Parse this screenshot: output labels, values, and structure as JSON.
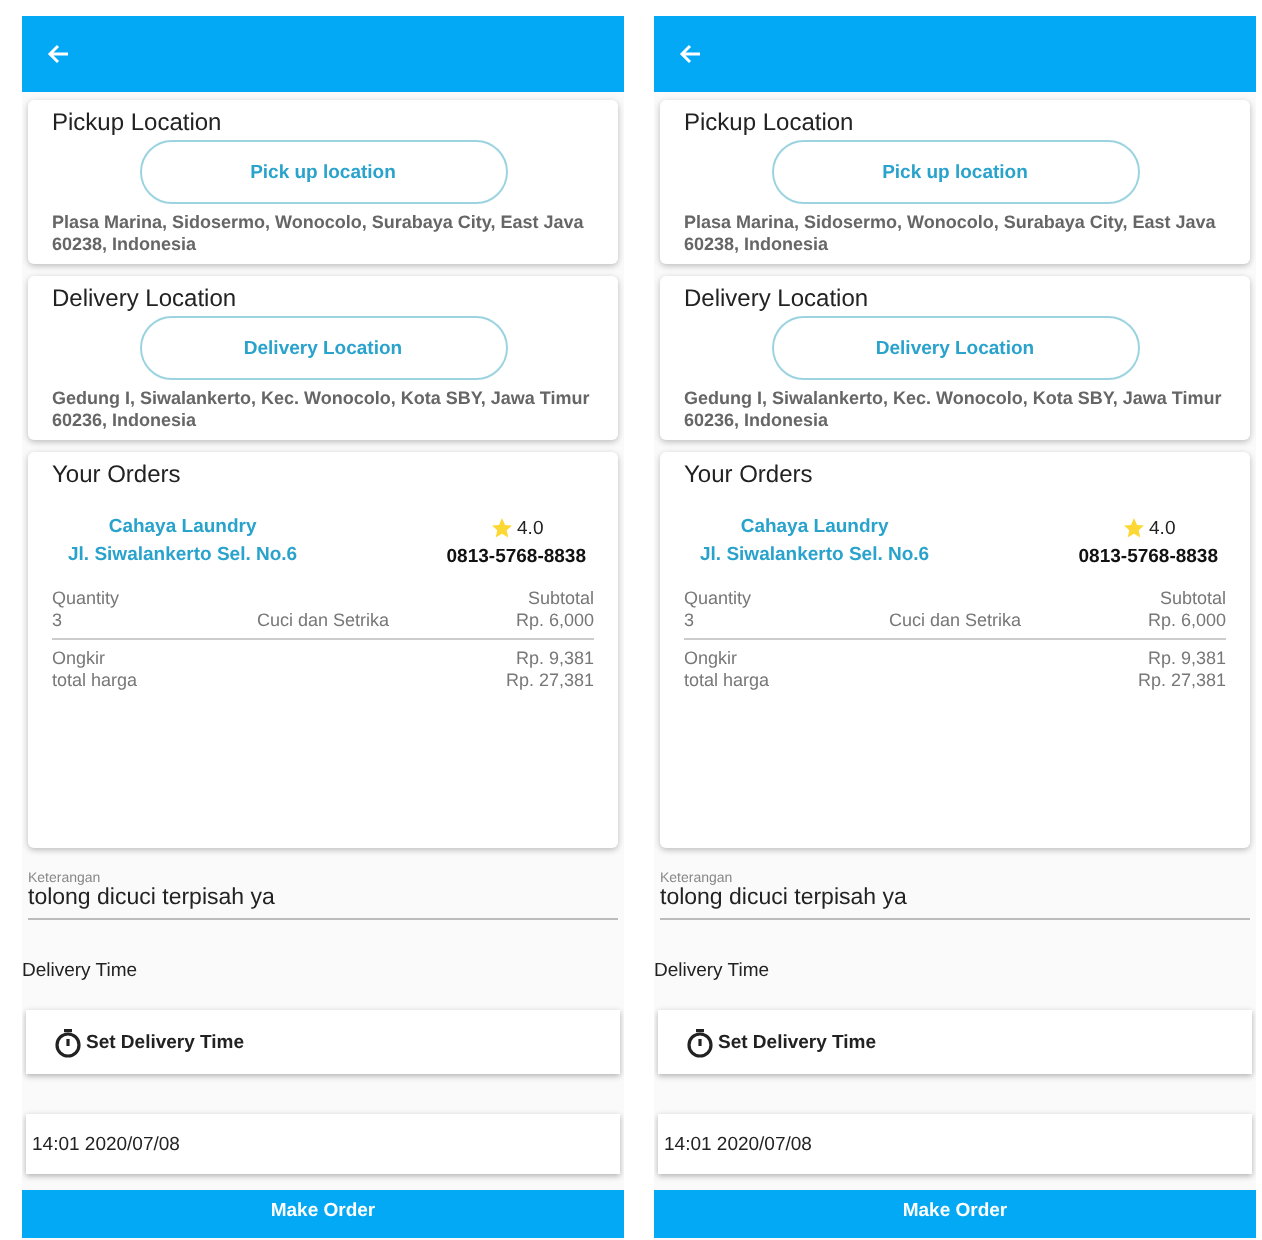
{
  "screens": [
    {
      "pickup": {
        "title": "Pickup Location",
        "button": "Pick up location",
        "address": "Plasa Marina, Sidosermo, Wonocolo, Surabaya City, East Java 60238, Indonesia"
      },
      "delivery": {
        "title": "Delivery Location",
        "button": "Delivery Location",
        "address": "Gedung I, Siwalankerto, Kec. Wonocolo, Kota SBY, Jawa Timur 60236, Indonesia"
      },
      "orders": {
        "title": "Your Orders",
        "laundry_name": "Cahaya  Laundry",
        "laundry_address": "Jl. Siwalankerto Sel. No.6",
        "rating": "4.0",
        "stars": 1,
        "phone": "0813-5768-8838",
        "quantity_label": "Quantity",
        "subtotal_label": "Subtotal",
        "quantity": "3",
        "service": "Cuci dan Setrika",
        "subtotal": "Rp. 6,000",
        "ongkir_label": "Ongkir",
        "ongkir": "Rp. 9,381",
        "total_label": "total harga",
        "total": "Rp. 27,381"
      },
      "note": {
        "label": "Keterangan",
        "value": "tolong dicuci terpisah ya"
      },
      "delivery_time_label": "Delivery Time",
      "set_time_button": "Set Delivery Time",
      "datetime": "14:01 2020/07/08",
      "make_order_button": "Make Order"
    },
    {
      "pickup": {
        "title": "Pickup Location",
        "button": "Pick up location",
        "address": "Plasa Marina, Sidosermo, Wonocolo, Surabaya City, East Java 60238, Indonesia"
      },
      "delivery": {
        "title": "Delivery Location",
        "button": "Delivery Location",
        "address": "Gedung I, Siwalankerto, Kec. Wonocolo, Kota SBY, Jawa Timur 60236, Indonesia"
      },
      "orders": {
        "title": "Your Orders",
        "laundry_name": "Cahaya  Laundry",
        "laundry_address": "Jl. Siwalankerto Sel. No.6",
        "rating": "4.0",
        "stars": 1,
        "phone": "0813-5768-8838",
        "quantity_label": "Quantity",
        "subtotal_label": "Subtotal",
        "quantity": "3",
        "service": "Cuci dan Setrika",
        "subtotal": "Rp. 6,000",
        "ongkir_label": "Ongkir",
        "ongkir": "Rp. 9,381",
        "total_label": "total harga",
        "total": "Rp. 27,381"
      },
      "note": {
        "label": "Keterangan",
        "value": "tolong dicuci terpisah ya"
      },
      "delivery_time_label": "Delivery Time",
      "set_time_button": "Set Delivery Time",
      "datetime": "14:01 2020/07/08",
      "make_order_button": "Make Order"
    }
  ]
}
